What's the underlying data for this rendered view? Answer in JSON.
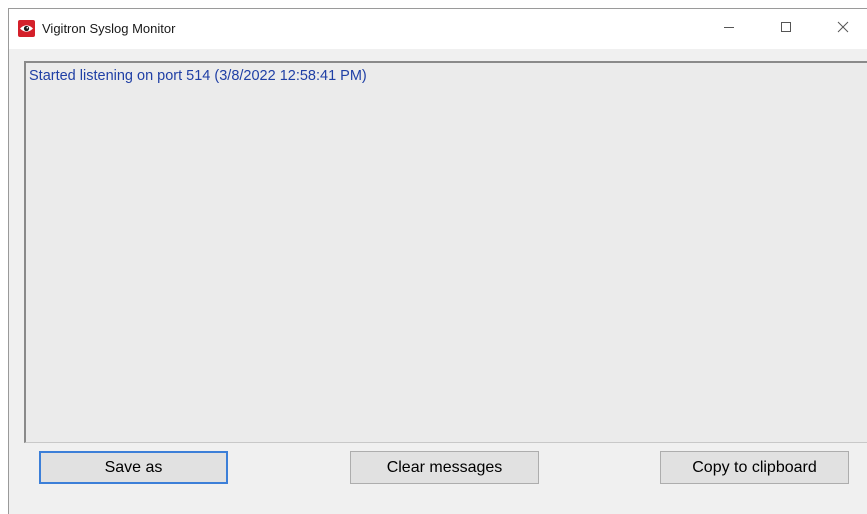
{
  "window": {
    "title": "Vigitron Syslog Monitor",
    "icon": "vigitron-eye-icon",
    "controls": [
      "minimize-icon",
      "maximize-icon",
      "close-icon"
    ]
  },
  "log": {
    "lines": [
      "Started listening on port 514 (3/8/2022 12:58:41 PM)"
    ],
    "text_color": "#1f3fa5"
  },
  "buttons": {
    "save_label": "Save as",
    "clear_label": "Clear messages",
    "copy_label": "Copy to clipboard"
  },
  "colors": {
    "focus_border": "#3c7fd8",
    "icon_red": "#d4202a"
  }
}
